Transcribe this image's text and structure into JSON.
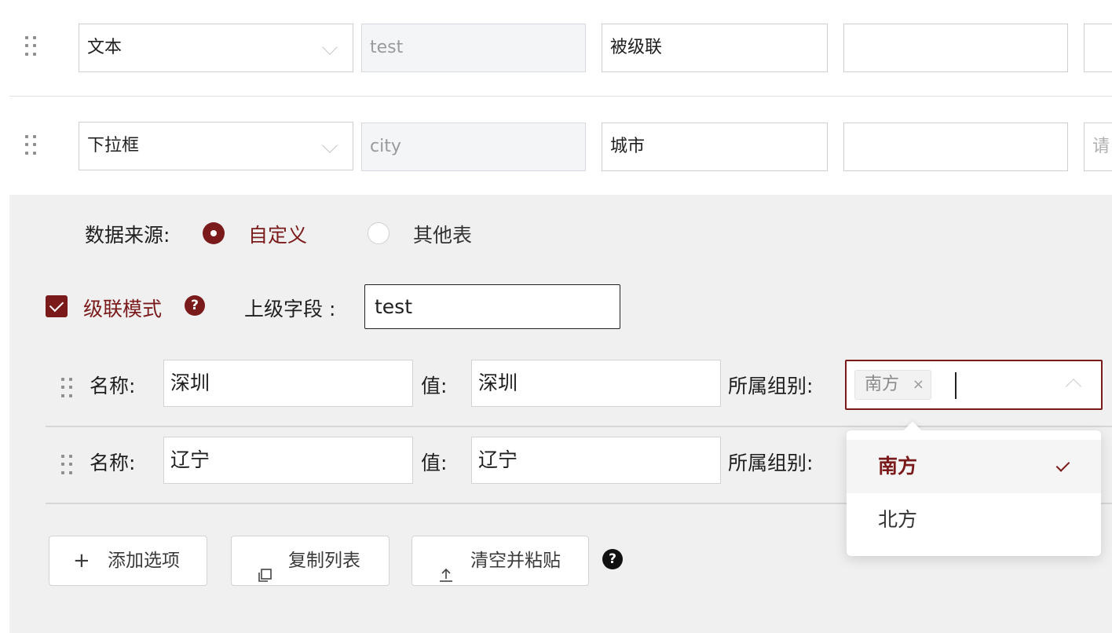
{
  "field_rows": [
    {
      "type": "文本",
      "key": "test",
      "label": "被级联",
      "extra": "",
      "fifth": ""
    },
    {
      "type": "下拉框",
      "key": "city",
      "label": "城市",
      "extra": "",
      "fifth": "请"
    }
  ],
  "data_source": {
    "label": "数据来源:",
    "options": [
      "自定义",
      "其他表"
    ],
    "selected": "自定义"
  },
  "cascade": {
    "label": "级联模式",
    "checked": true,
    "parent_label": "上级字段 :",
    "parent_value": "test"
  },
  "options": [
    {
      "name_label": "名称:",
      "name": "深圳",
      "value_label": "值:",
      "value": "深圳",
      "group_label": "所属组别:",
      "groups": [
        "南方"
      ]
    },
    {
      "name_label": "名称:",
      "name": "辽宁",
      "value_label": "值:",
      "value": "辽宁",
      "group_label": "所属组别:",
      "groups": []
    }
  ],
  "group_dropdown": {
    "items": [
      {
        "label": "南方",
        "selected": true
      },
      {
        "label": "北方",
        "selected": false
      }
    ]
  },
  "actions": {
    "add": "添加选项",
    "copy": "复制列表",
    "clear_paste": "清空并粘贴"
  },
  "help_glyph": "?",
  "tag_remove_glyph": "×",
  "colors": {
    "accent": "#7a1a1a",
    "panel_bg": "#f0f0f0"
  },
  "icons": [
    "drag-handle-icon",
    "chevron-down-icon",
    "question-icon",
    "plus-icon",
    "copy-icon",
    "upload-icon",
    "check-icon",
    "close-icon",
    "chevron-up-icon"
  ]
}
